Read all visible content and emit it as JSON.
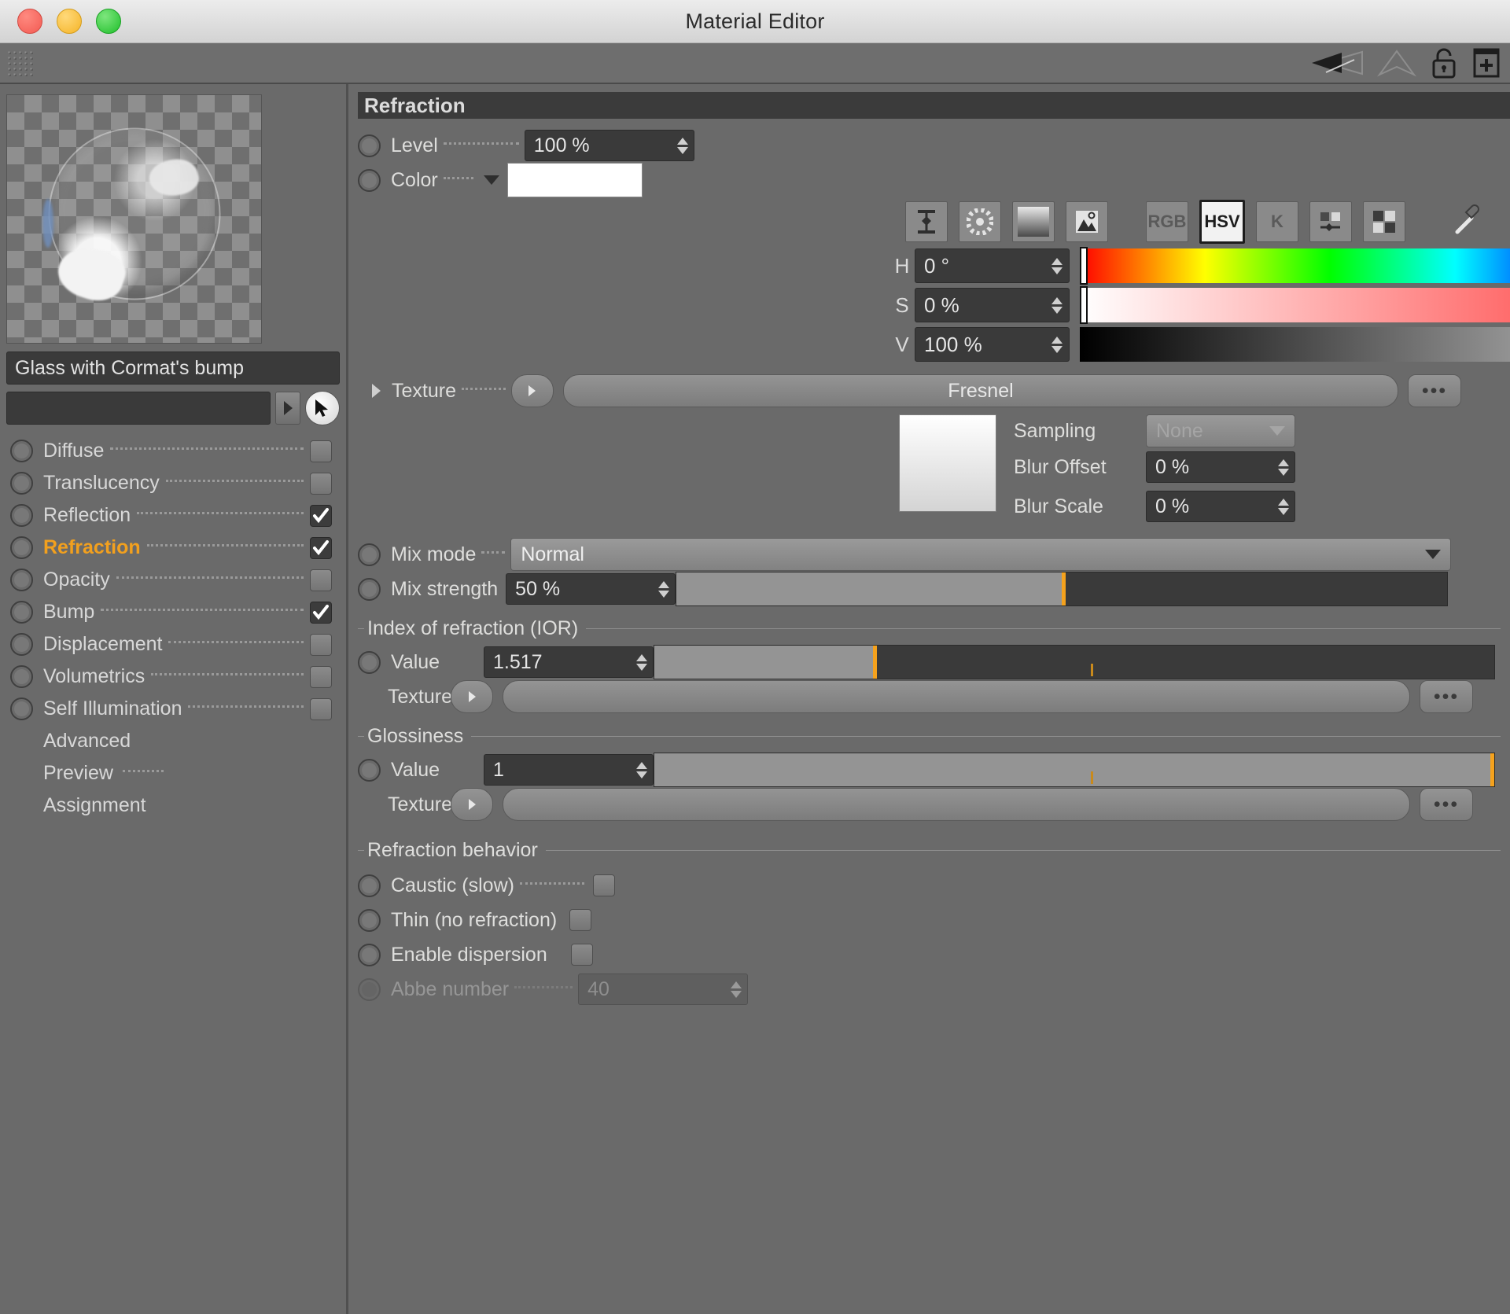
{
  "window": {
    "title": "Material Editor",
    "traffic_lights": [
      "close-button",
      "minimize-button",
      "zoom-button"
    ]
  },
  "toolbar": {
    "grip": "drag-grip",
    "icons": [
      "back-arrow-icon",
      "forward-arrow-icon",
      "unlock-icon",
      "add-panel-icon"
    ]
  },
  "sidebar": {
    "preview_name": "material-preview",
    "material_name": "Glass with Cormat's bump",
    "link_field_value": "",
    "link_arrow": "▸",
    "picker_icon": "cursor-picker-icon",
    "channels": [
      {
        "label": "Diffuse",
        "checked": false,
        "active": false
      },
      {
        "label": "Translucency",
        "checked": false,
        "active": false
      },
      {
        "label": "Reflection",
        "checked": true,
        "active": false
      },
      {
        "label": "Refraction",
        "checked": true,
        "active": true
      },
      {
        "label": "Opacity",
        "checked": false,
        "active": false
      },
      {
        "label": "Bump",
        "checked": true,
        "active": false
      },
      {
        "label": "Displacement",
        "checked": false,
        "active": false
      },
      {
        "label": "Volumetrics",
        "checked": false,
        "active": false
      },
      {
        "label": "Self Illumination",
        "checked": false,
        "active": false
      }
    ],
    "extra_items": [
      {
        "label": "Advanced",
        "dots": false
      },
      {
        "label": "Preview",
        "dots": true
      },
      {
        "label": "Assignment",
        "dots": false
      }
    ]
  },
  "main": {
    "section_title": "Refraction",
    "level": {
      "label": "Level",
      "value": "100 %"
    },
    "color": {
      "label": "Color",
      "swatch_hex": "#ffffff",
      "modes": [
        {
          "name": "range-slider-icon",
          "text": "",
          "selected": false
        },
        {
          "name": "color-wheel-icon",
          "text": "",
          "selected": false
        },
        {
          "name": "gradient-icon",
          "text": "",
          "selected": false
        },
        {
          "name": "image-picker-icon",
          "text": "",
          "selected": false
        },
        {
          "name": "rgb-mode-button",
          "text": "RGB",
          "selected": false
        },
        {
          "name": "hsv-mode-button",
          "text": "HSV",
          "selected": true
        },
        {
          "name": "kelvin-mode-button",
          "text": "K",
          "selected": false
        },
        {
          "name": "mixer-icon",
          "text": "",
          "selected": false
        },
        {
          "name": "swatches-icon",
          "text": "",
          "selected": false
        },
        {
          "name": "eyedropper-icon",
          "text": "",
          "selected": false
        }
      ],
      "hsv": [
        {
          "key": "H",
          "value": "0 °",
          "marker_pct": 0
        },
        {
          "key": "S",
          "value": "0 %",
          "marker_pct": 0
        },
        {
          "key": "V",
          "value": "100 %",
          "marker_pct": 100
        }
      ]
    },
    "texture": {
      "label": "Texture",
      "value": "Fresnel",
      "more_label": "•••",
      "sampling": {
        "label": "Sampling",
        "value": "None"
      },
      "blur_offset": {
        "label": "Blur Offset",
        "value": "0 %"
      },
      "blur_scale": {
        "label": "Blur Scale",
        "value": "0 %"
      }
    },
    "mix_mode": {
      "label": "Mix mode",
      "value": "Normal"
    },
    "mix_strength": {
      "label": "Mix strength",
      "value": "50 %",
      "fill_pct": 50
    },
    "ior": {
      "group_label": "Index of refraction (IOR)",
      "value_label": "Value",
      "value": "1.517",
      "fill_pct": 26,
      "tick_pct": 52,
      "texture_label": "Texture",
      "texture_value": "",
      "more_label": "•••"
    },
    "glossiness": {
      "group_label": "Glossiness",
      "value_label": "Value",
      "value": "1",
      "fill_pct": 100,
      "tick_pct": 52,
      "texture_label": "Texture",
      "texture_value": "",
      "more_label": "•••"
    },
    "behavior": {
      "group_label": "Refraction behavior",
      "options": [
        {
          "label": "Caustic (slow)",
          "checked": false,
          "disabled": false
        },
        {
          "label": "Thin (no refraction)",
          "checked": false,
          "disabled": false
        },
        {
          "label": "Enable dispersion",
          "checked": false,
          "disabled": false
        }
      ],
      "abbe": {
        "label": "Abbe number",
        "value": "40",
        "disabled": true
      }
    }
  },
  "colors": {
    "accent": "#f2a01e",
    "panel_bg": "#6a6a6a",
    "field_bg": "#3a3a3a",
    "text": "#dededc"
  }
}
